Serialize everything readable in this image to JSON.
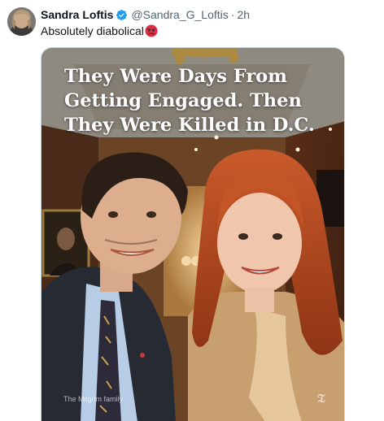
{
  "tweet": {
    "author": {
      "display_name": "Sandra Loftis",
      "verified": true,
      "handle": "@Sandra_G_Loftis",
      "separator": "·",
      "time": "2h"
    },
    "text": "Absolutely diabolical",
    "text_emoji": "angry-face-emoji"
  },
  "media": {
    "headline": "They Were Days From Getting Engaged. Then They Were Killed in D.C.",
    "credit": "The Milgrim family",
    "logo": "nyt-logo-icon"
  },
  "colors": {
    "verified_badge": "#1d9bf0",
    "secondary_text": "#536471",
    "primary_text": "#0f1419",
    "border": "#cfd9de"
  }
}
